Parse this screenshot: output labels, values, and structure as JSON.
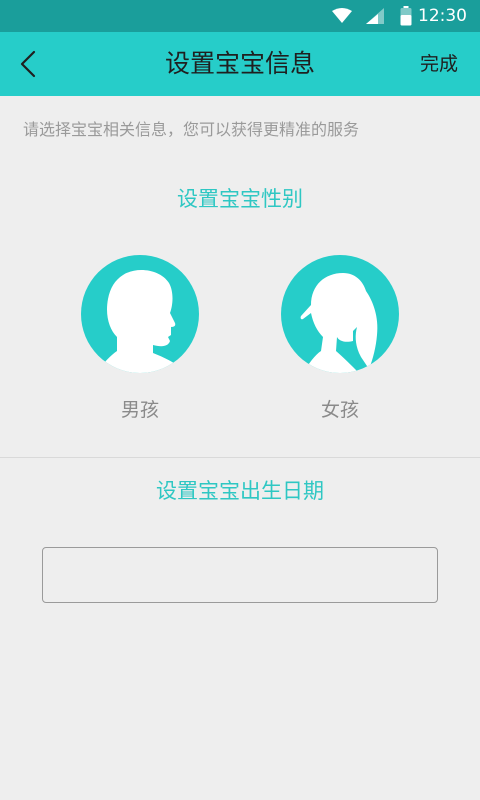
{
  "status_bar": {
    "time": "12:30"
  },
  "app_bar": {
    "title": "设置宝宝信息",
    "done_label": "完成"
  },
  "hint": "请选择宝宝相关信息，您可以获得更精准的服务",
  "gender_section": {
    "title": "设置宝宝性别",
    "options": [
      {
        "label": "男孩",
        "icon": "boy-silhouette-icon"
      },
      {
        "label": "女孩",
        "icon": "girl-silhouette-icon"
      }
    ]
  },
  "birthday_section": {
    "title": "设置宝宝出生日期",
    "value": ""
  },
  "colors": {
    "status_bar": "#1a9e9b",
    "accent": "#26cdc9",
    "background": "#eeeeee"
  }
}
